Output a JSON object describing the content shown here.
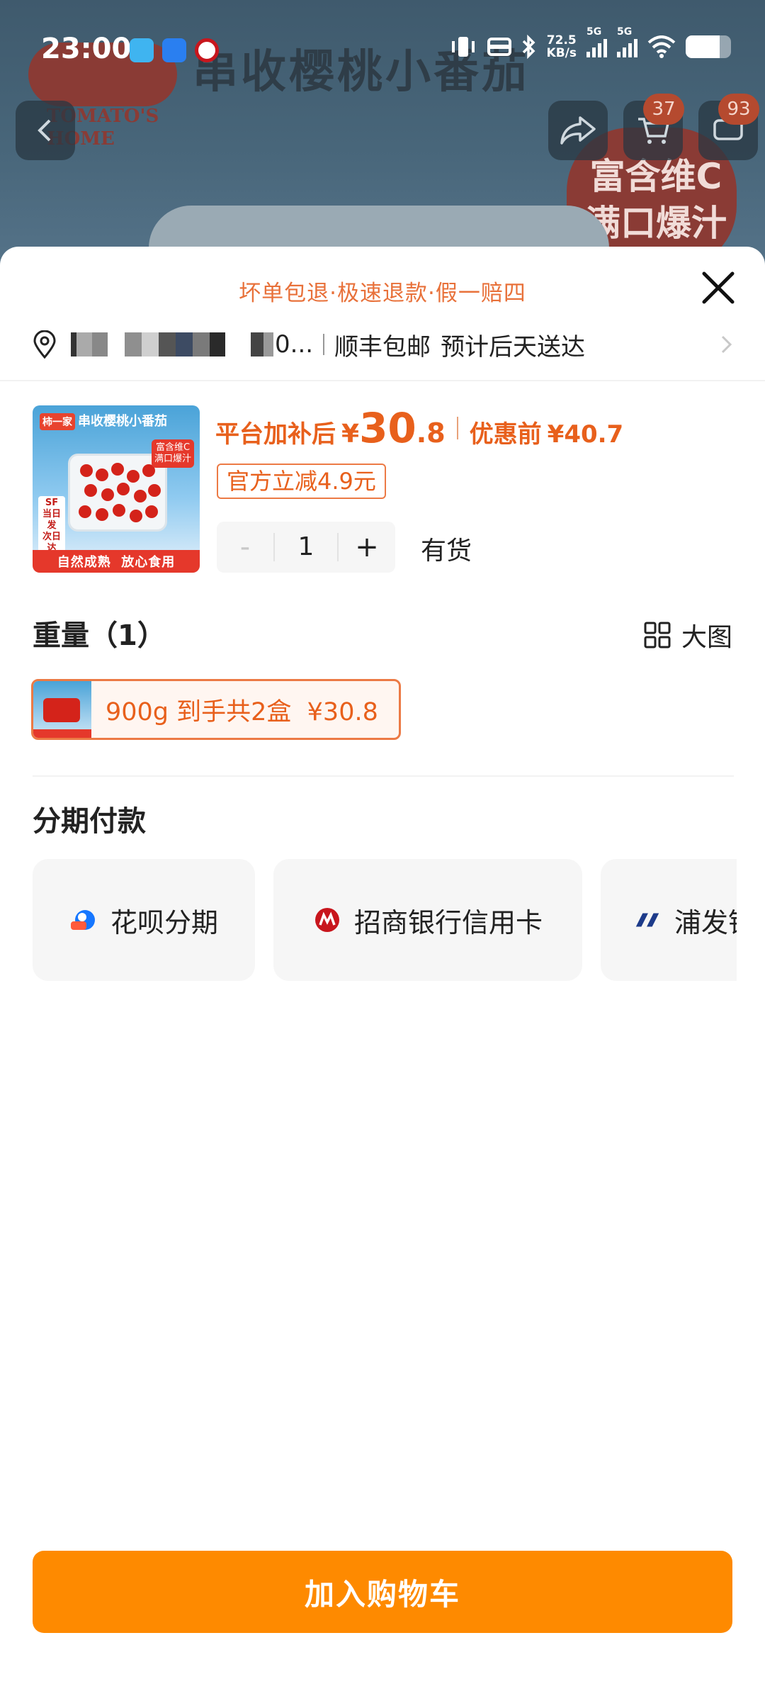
{
  "status_bar": {
    "time": "23:00",
    "net_speed_value": "72.5",
    "net_speed_unit": "KB/s",
    "sim1": "5G",
    "sim2": "5G"
  },
  "background_page": {
    "brand_cn": "柿一家",
    "product_headline": "串收樱桃小番茄",
    "brand_en_line1": "TOMATO'S",
    "brand_en_line2": "HOME",
    "tag_line1": "富含维C",
    "tag_line2": "满口爆汁",
    "cart_badge": "37",
    "msg_badge": "93"
  },
  "sheet": {
    "guarantee": "坏单包退·极速退款·假一赔四",
    "address": {
      "masked_suffix": "0...",
      "shipping": "顺丰包邮",
      "eta": "预计后天送达"
    },
    "product": {
      "thumb_logo": "柿一家",
      "thumb_title": "串收樱桃小番茄",
      "thumb_tag": "富含维C\n满口爆汁",
      "thumb_sf": "SF\n当日发\n次日达",
      "thumb_footer": "自然成熟  放心食用",
      "price_label": "平台加补后",
      "currency": "¥",
      "price_int": "30",
      "price_dec": ".8",
      "orig_label": "优惠前",
      "orig_price": "¥40.7",
      "coupon": "官方立减4.9元",
      "quantity": "1",
      "minus": "-",
      "plus": "+",
      "stock": "有货"
    },
    "weight": {
      "title": "重量（1）",
      "big_view": "大图",
      "option": "900g 到手共2盒  ¥30.8"
    },
    "installment": {
      "title": "分期付款",
      "options": [
        {
          "label": "花呗分期",
          "icon": "huabei-icon"
        },
        {
          "label": "招商银行信用卡",
          "icon": "cmb-icon"
        },
        {
          "label": "浦发银行",
          "icon": "spdb-icon"
        }
      ]
    },
    "cta": "加入购物车"
  },
  "colors": {
    "accent_orange": "#fe8a00",
    "price_orange": "#e8601c",
    "coupon_border": "#ec7a45"
  }
}
